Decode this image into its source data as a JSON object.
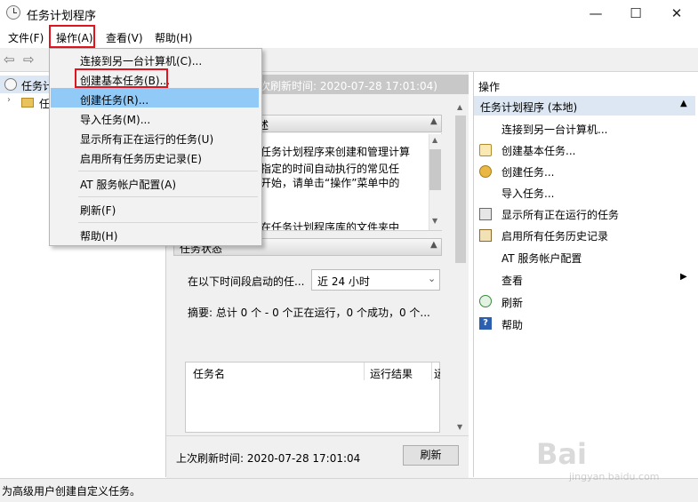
{
  "window": {
    "title": "任务计划程序",
    "minimize": "—",
    "maximize": "☐",
    "close": "✕"
  },
  "menubar": {
    "file": "文件(F)",
    "action": "操作(A)",
    "view": "查看(V)",
    "help": "帮助(H)"
  },
  "toolbar": {
    "back": "⇦",
    "forward": "⇨"
  },
  "tree": {
    "root": "任务计",
    "child": "任"
  },
  "center": {
    "header_text": "次刷新时间: 2020-07-28 17:01:04)",
    "summary_header": "述",
    "desc_lines": [
      "任务计划程序来创建和管理计算",
      "指定的时间自动执行的常见任",
      "开始，请单击“操作”菜单中的",
      "在任务计划程序库的文件夹中"
    ],
    "status_header": "任务状态",
    "period_label": "在以下时间段启动的任...",
    "period_value": "近 24 小时",
    "summary_text": "摘要: 总计 0 个 - 0 个正在运行，0 个成功，0 个...",
    "table_col_name": "任务名",
    "table_col_result": "运行结果",
    "table_col_extra": "运",
    "last_refresh": "上次刷新时间: 2020-07-28 17:01:04",
    "refresh_button": "刷新"
  },
  "actions": {
    "header": "操作",
    "section": "任务计划程序 (本地)",
    "items": [
      "连接到另一台计算机...",
      "创建基本任务...",
      "创建任务...",
      "导入任务...",
      "显示所有正在运行的任务",
      "启用所有任务历史记录",
      "AT 服务帐户配置",
      "查看",
      "刷新",
      "帮助"
    ]
  },
  "dropdown": {
    "items": [
      "连接到另一台计算机(C)...",
      "创建基本任务(B)...",
      "创建任务(R)...",
      "导入任务(M)...",
      "显示所有正在运行的任务(U)",
      "启用所有任务历史记录(E)",
      "AT 服务帐户配置(A)",
      "刷新(F)",
      "帮助(H)"
    ]
  },
  "statusbar": {
    "text": "为高级用户创建自定义任务。"
  },
  "watermark": {
    "text": "Bai",
    "sub": "jingyan.baidu.com"
  }
}
